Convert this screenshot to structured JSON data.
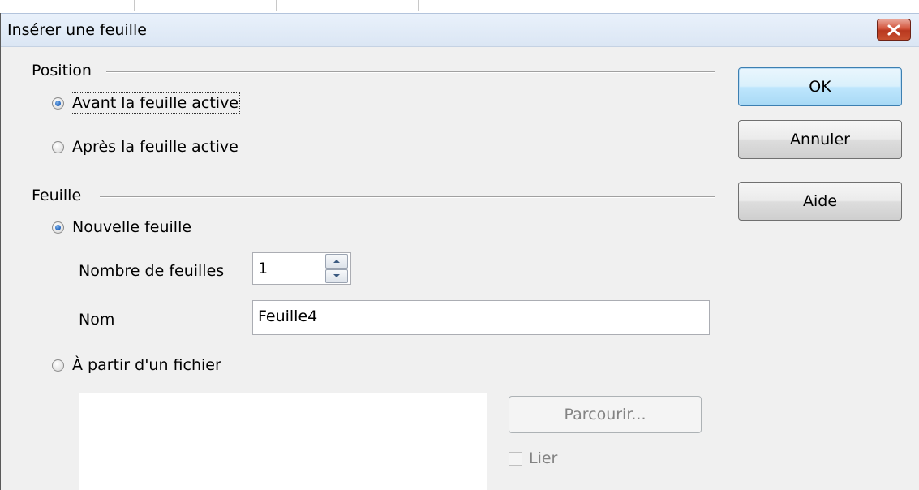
{
  "window": {
    "title": "Insérer une feuille"
  },
  "position": {
    "label": "Position",
    "options": [
      {
        "label": "Avant la feuille active",
        "checked": true
      },
      {
        "label": "Après la feuille active",
        "checked": false
      }
    ]
  },
  "sheet": {
    "label": "Feuille",
    "new_sheet": {
      "label": "Nouvelle feuille",
      "checked": true
    },
    "count": {
      "label": "Nombre de feuilles",
      "value": "1"
    },
    "name": {
      "label": "Nom",
      "value": "Feuille4"
    },
    "from_file": {
      "label": "À partir d'un fichier",
      "checked": false
    },
    "browse_label": "Parcourir...",
    "link_label": "Lier"
  },
  "buttons": {
    "ok": "OK",
    "cancel": "Annuler",
    "help": "Aide"
  },
  "icons": {
    "close": "close-icon",
    "spin_up": "spin-up-icon",
    "spin_down": "spin-down-icon"
  },
  "colors": {
    "close_button": "#c8503a",
    "default_button_border": "#3c7fb1",
    "radio_dot": "#2b6cc4"
  }
}
